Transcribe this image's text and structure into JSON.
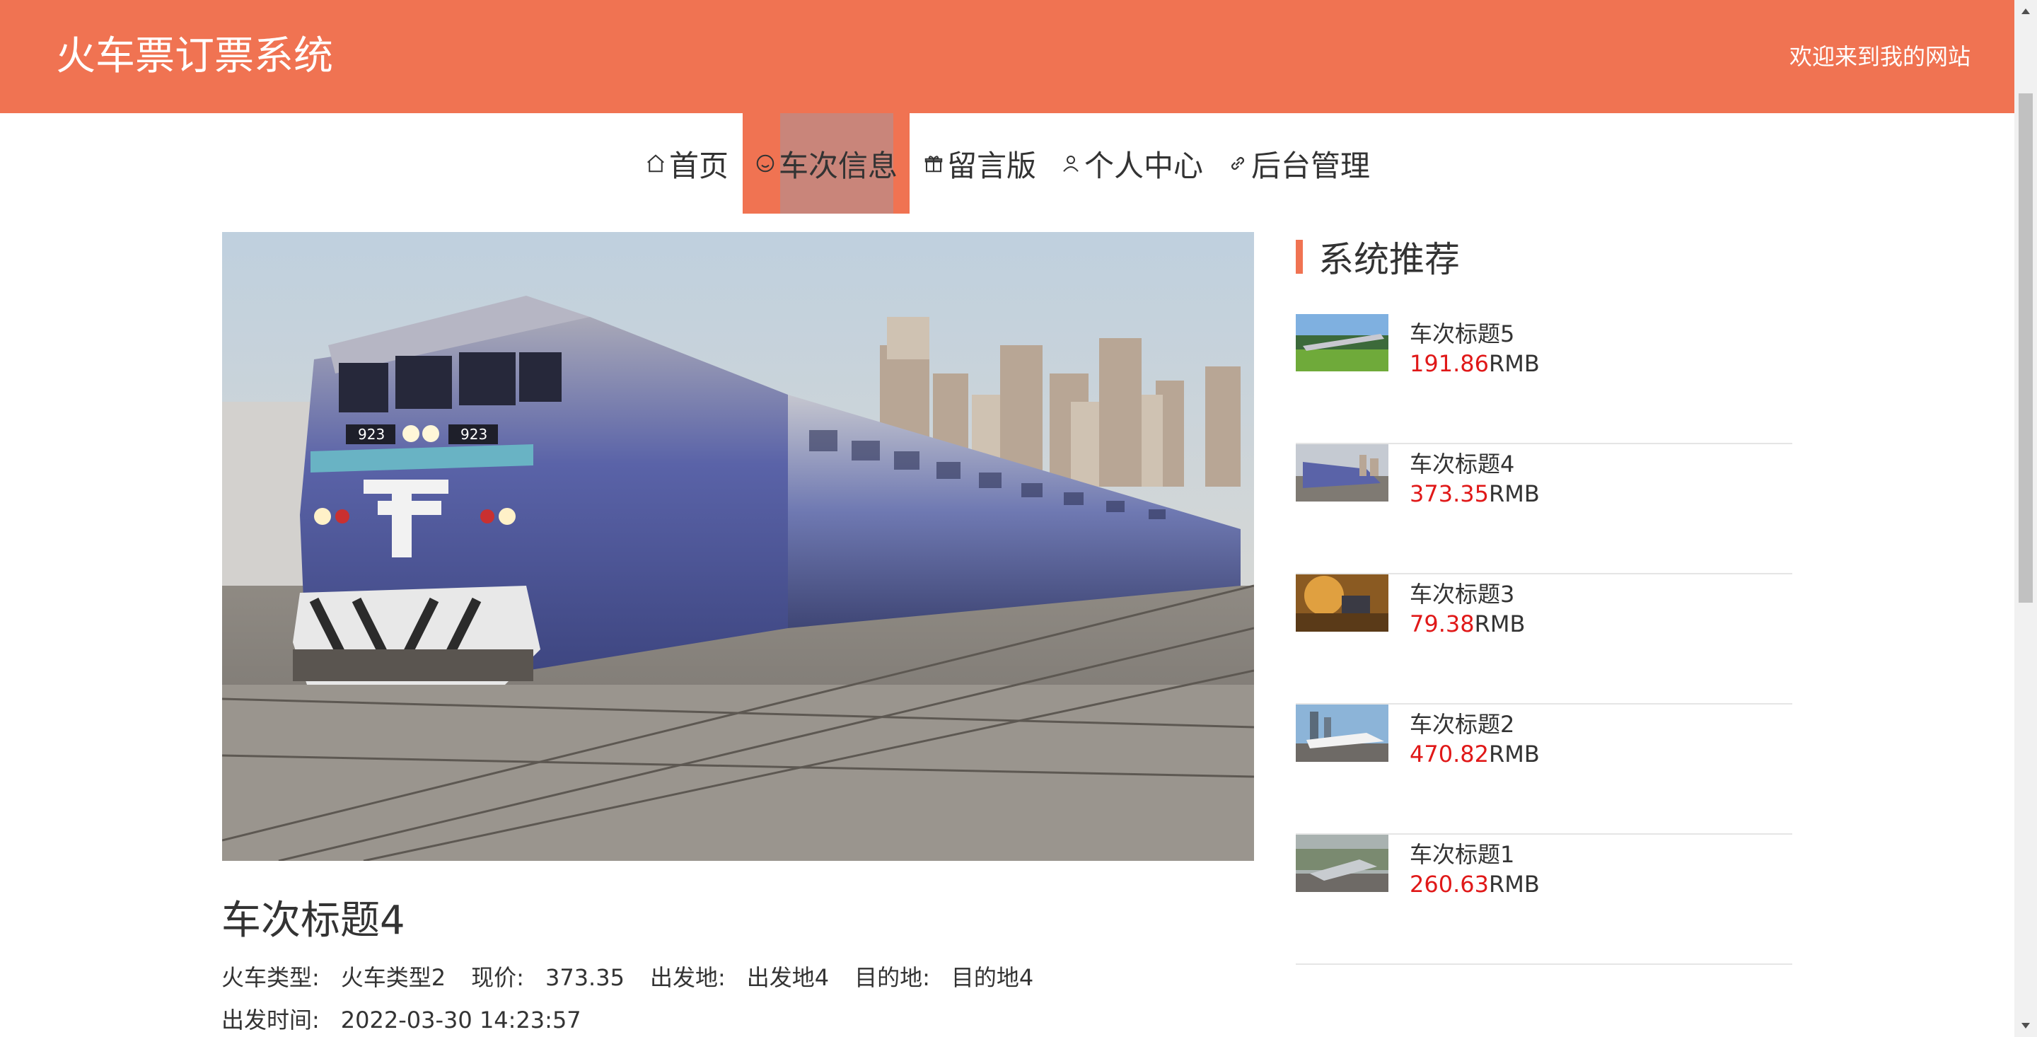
{
  "header": {
    "title": "火车票订票系统",
    "welcome": "欢迎来到我的网站"
  },
  "nav": {
    "items": [
      {
        "label": "首页",
        "icon": "home-icon"
      },
      {
        "label": "车次信息",
        "icon": "smile-icon",
        "active": true
      },
      {
        "label": "留言版",
        "icon": "gift-icon"
      },
      {
        "label": "个人中心",
        "icon": "user-icon"
      },
      {
        "label": "后台管理",
        "icon": "link-icon"
      }
    ]
  },
  "detail": {
    "title": "车次标题4",
    "train_type_label": "火车类型:",
    "train_type_value": "火车类型2",
    "price_label": "现价:",
    "price_value": "373.35",
    "departure_label": "出发地:",
    "departure_value": "出发地4",
    "destination_label": "目的地:",
    "destination_value": "目的地4",
    "depart_time_label": "出发时间:",
    "depart_time_value": "2022-03-30 14:23:57"
  },
  "sidebar": {
    "title": "系统推荐",
    "items": [
      {
        "name": "车次标题5",
        "price": "191.86",
        "unit": "RMB"
      },
      {
        "name": "车次标题4",
        "price": "373.35",
        "unit": "RMB"
      },
      {
        "name": "车次标题3",
        "price": "79.38",
        "unit": "RMB"
      },
      {
        "name": "车次标题2",
        "price": "470.82",
        "unit": "RMB"
      },
      {
        "name": "车次标题1",
        "price": "260.63",
        "unit": "RMB"
      }
    ]
  },
  "colors": {
    "accent": "#F07352",
    "price": "#E01818",
    "active_nav_inner": "#C9857A"
  }
}
